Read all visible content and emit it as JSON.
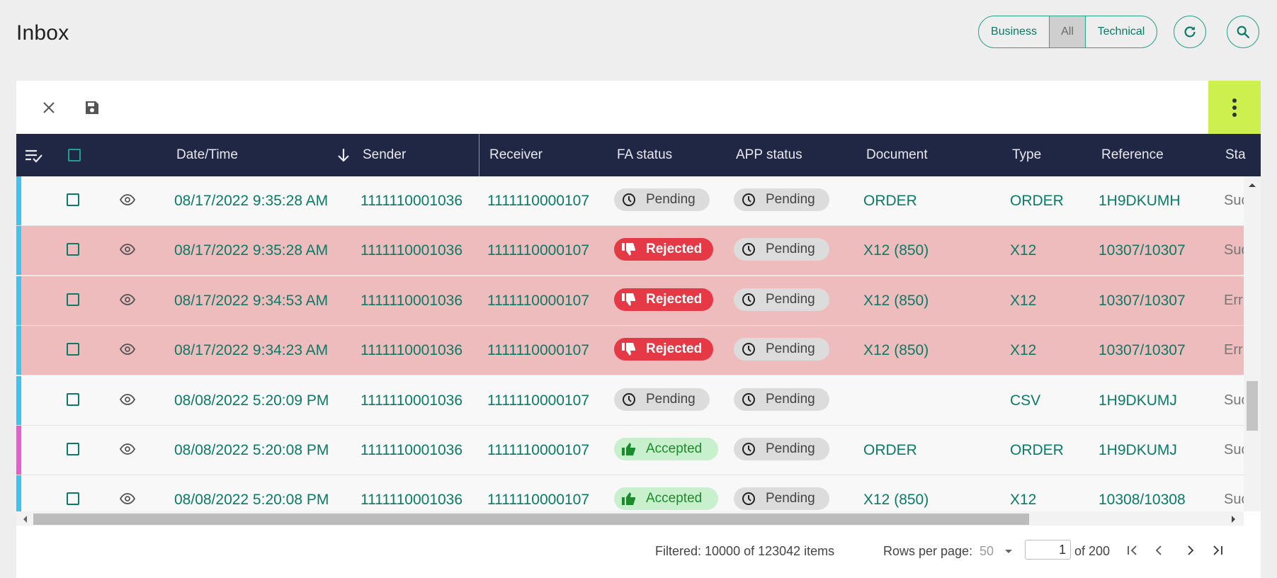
{
  "page": {
    "title": "Inbox"
  },
  "filter": {
    "business": "Business",
    "all": "All",
    "technical": "Technical",
    "selected": "All"
  },
  "icons": {
    "refresh": "refresh-icon",
    "search": "search-icon",
    "close": "close-icon",
    "save": "save-icon",
    "more": "more-vertical-icon"
  },
  "colors": {
    "accent": "#0b7a66",
    "header_bg": "#1f2744",
    "kebab_bg": "#cdf04f",
    "rejected_row": "#efbcbd",
    "strip_blue": "#3ec4f0",
    "strip_pink": "#e85ccf"
  },
  "table": {
    "columns": {
      "datetime": "Date/Time",
      "sender": "Sender",
      "receiver": "Receiver",
      "fa_status": "FA status",
      "app_status": "APP status",
      "document": "Document",
      "type": "Type",
      "reference": "Reference",
      "status": "Sta"
    },
    "sort": {
      "column": "Date/Time",
      "direction": "descending"
    },
    "rows": [
      {
        "strip": "blue",
        "datetime": "08/17/2022 9:35:28 AM",
        "sender": "1111110001036",
        "receiver": "1111110000107",
        "fa": "Pending",
        "app": "Pending",
        "document": "ORDER",
        "type": "ORDER",
        "reference": "1H9DKUMH",
        "status": "Suc",
        "rejected": false
      },
      {
        "strip": "blue",
        "datetime": "08/17/2022 9:35:28 AM",
        "sender": "1111110001036",
        "receiver": "1111110000107",
        "fa": "Rejected",
        "app": "Pending",
        "document": "X12 (850)",
        "type": "X12",
        "reference": "10307/10307",
        "status": "Suc",
        "rejected": true
      },
      {
        "strip": "blue",
        "datetime": "08/17/2022 9:34:53 AM",
        "sender": "1111110001036",
        "receiver": "1111110000107",
        "fa": "Rejected",
        "app": "Pending",
        "document": "X12 (850)",
        "type": "X12",
        "reference": "10307/10307",
        "status": "Err",
        "rejected": true
      },
      {
        "strip": "blue",
        "datetime": "08/17/2022 9:34:23 AM",
        "sender": "1111110001036",
        "receiver": "1111110000107",
        "fa": "Rejected",
        "app": "Pending",
        "document": "X12 (850)",
        "type": "X12",
        "reference": "10307/10307",
        "status": "Err",
        "rejected": true
      },
      {
        "strip": "blue",
        "datetime": "08/08/2022 5:20:09 PM",
        "sender": "1111110001036",
        "receiver": "1111110000107",
        "fa": "Pending",
        "app": "Pending",
        "document": "",
        "type": "CSV",
        "reference": "1H9DKUMJ",
        "status": "Suc",
        "rejected": false
      },
      {
        "strip": "pink",
        "datetime": "08/08/2022 5:20:08 PM",
        "sender": "1111110001036",
        "receiver": "1111110000107",
        "fa": "Accepted",
        "app": "Pending",
        "document": "ORDER",
        "type": "ORDER",
        "reference": "1H9DKUMJ",
        "status": "Suc",
        "rejected": false
      },
      {
        "strip": "blue",
        "datetime": "08/08/2022 5:20:08 PM",
        "sender": "1111110001036",
        "receiver": "1111110000107",
        "fa": "Accepted",
        "app": "Pending",
        "document": "X12 (850)",
        "type": "X12",
        "reference": "10308/10308",
        "status": "Suc",
        "rejected": false
      }
    ]
  },
  "footer": {
    "filtered": "Filtered: 10000 of 123042 items",
    "rows_per_page_label": "Rows per page:",
    "rows_per_page": "50",
    "page": "1",
    "of_pages": "of 200"
  }
}
